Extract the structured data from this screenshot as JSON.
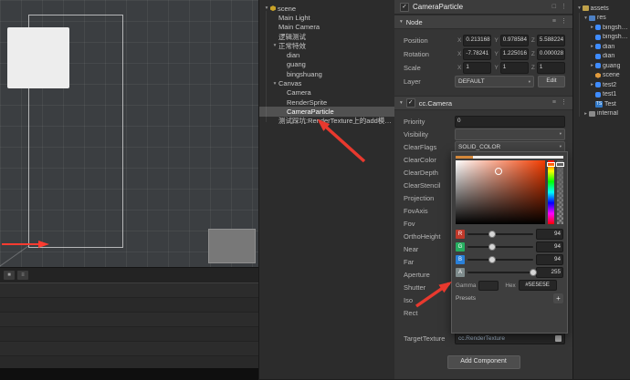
{
  "ui": {
    "caret": "▾",
    "expand": "▾",
    "check": "✓"
  },
  "annotations": {
    "color": "#e8392e"
  },
  "timeline": {
    "icons": [
      "■",
      "≡"
    ]
  },
  "hierarchy": {
    "items": [
      {
        "label": "scene",
        "depth": 0,
        "arrow": "▾",
        "icon": "hex-gold"
      },
      {
        "label": "Main Light",
        "depth": 1,
        "arrow": ""
      },
      {
        "label": "Main Camera",
        "depth": 1,
        "arrow": ""
      },
      {
        "label": "逻辑测试",
        "depth": 1,
        "arrow": ""
      },
      {
        "label": "正常特效",
        "depth": 1,
        "arrow": "▾"
      },
      {
        "label": "dian",
        "depth": 2,
        "arrow": ""
      },
      {
        "label": "guang",
        "depth": 2,
        "arrow": ""
      },
      {
        "label": "bingshuang",
        "depth": 2,
        "arrow": ""
      },
      {
        "label": "Canvas",
        "depth": 1,
        "arrow": "▾"
      },
      {
        "label": "Camera",
        "depth": 2,
        "arrow": ""
      },
      {
        "label": "RenderSprite",
        "depth": 2,
        "arrow": ""
      },
      {
        "label": "CameraParticle",
        "depth": 2,
        "arrow": "",
        "selected": true
      },
      {
        "label": "测试踩坑:RenderTexture上的add模式也有问题 添加异...",
        "depth": 1,
        "arrow": ""
      }
    ]
  },
  "inspector": {
    "header": {
      "name": "CameraParticle",
      "icons": [
        "□",
        "⋮"
      ]
    },
    "section_icons": [
      "≡",
      "⋮"
    ],
    "node": {
      "title": "Node",
      "axis_labels": {
        "x": "X",
        "y": "Y",
        "z": "Z"
      },
      "transform": [
        {
          "label": "Position",
          "x": "0.213168",
          "y": "0.978584",
          "z": "5.588224"
        },
        {
          "label": "Rotation",
          "x": "-7.78241",
          "y": "1.225016",
          "z": "0.000028"
        },
        {
          "label": "Scale",
          "x": "1",
          "y": "1",
          "z": "1"
        }
      ],
      "layer": {
        "label": "Layer",
        "value": "DEFAULT",
        "edit_button": "Edit"
      }
    },
    "camera": {
      "title": "cc.Camera",
      "priority": {
        "label": "Priority",
        "value": "0"
      },
      "visibility": {
        "label": "Visibility",
        "value": ""
      },
      "clear_flags": {
        "label": "ClearFlags",
        "value": "SOLID_COLOR"
      },
      "plain_labels": [
        "ClearColor",
        "ClearDepth",
        "ClearStencil",
        "Projection",
        "FovAxis",
        "Fov",
        "OrthoHeight",
        "Near",
        "Far",
        "Aperture",
        "Shutter",
        "Iso",
        "Rect"
      ],
      "target_texture": {
        "label": "TargetTexture",
        "value": "cc.RenderTexture"
      }
    },
    "add_component_button": "Add Component"
  },
  "color_picker": {
    "channels": [
      {
        "label": "R",
        "value": "94",
        "chip": "#c0392b",
        "fraction": 0.37
      },
      {
        "label": "G",
        "value": "94",
        "chip": "#27ae60",
        "fraction": 0.37
      },
      {
        "label": "B",
        "value": "94",
        "chip": "#2980d9",
        "fraction": 0.37
      },
      {
        "label": "A",
        "value": "255",
        "chip": "#7f8c8d",
        "fraction": 1.0
      }
    ],
    "gamma_label": "Gamma",
    "hex_label": "Hex",
    "hex_value": "#5E5E5E",
    "presets_label": "Presets",
    "add_preset": "+"
  },
  "assets": {
    "items": [
      {
        "label": "assets",
        "depth": 0,
        "arrow": "▾",
        "icon": "box-yellow"
      },
      {
        "label": "res",
        "depth": 1,
        "arrow": "▾",
        "icon": "folder-blue"
      },
      {
        "label": "bingshuang",
        "depth": 2,
        "arrow": "▸",
        "icon": "dot-blue"
      },
      {
        "label": "bingshuang",
        "depth": 2,
        "arrow": "",
        "icon": "dot-blue"
      },
      {
        "label": "dian",
        "depth": 2,
        "arrow": "▸",
        "icon": "dot-blue"
      },
      {
        "label": "dian",
        "depth": 2,
        "arrow": "",
        "icon": "dot-blue"
      },
      {
        "label": "guang",
        "depth": 2,
        "arrow": "▸",
        "icon": "dot-blue"
      },
      {
        "label": "scene",
        "depth": 2,
        "arrow": "",
        "icon": "hex-orange"
      },
      {
        "label": "test2",
        "depth": 2,
        "arrow": "▸",
        "icon": "dot-blue"
      },
      {
        "label": "test1",
        "depth": 2,
        "arrow": "",
        "icon": "dot-blue"
      },
      {
        "label": "Test",
        "depth": 2,
        "arrow": "",
        "icon": "ts-badge",
        "badge": "TS"
      },
      {
        "label": "internal",
        "depth": 1,
        "arrow": "▸",
        "icon": "folder"
      }
    ]
  }
}
